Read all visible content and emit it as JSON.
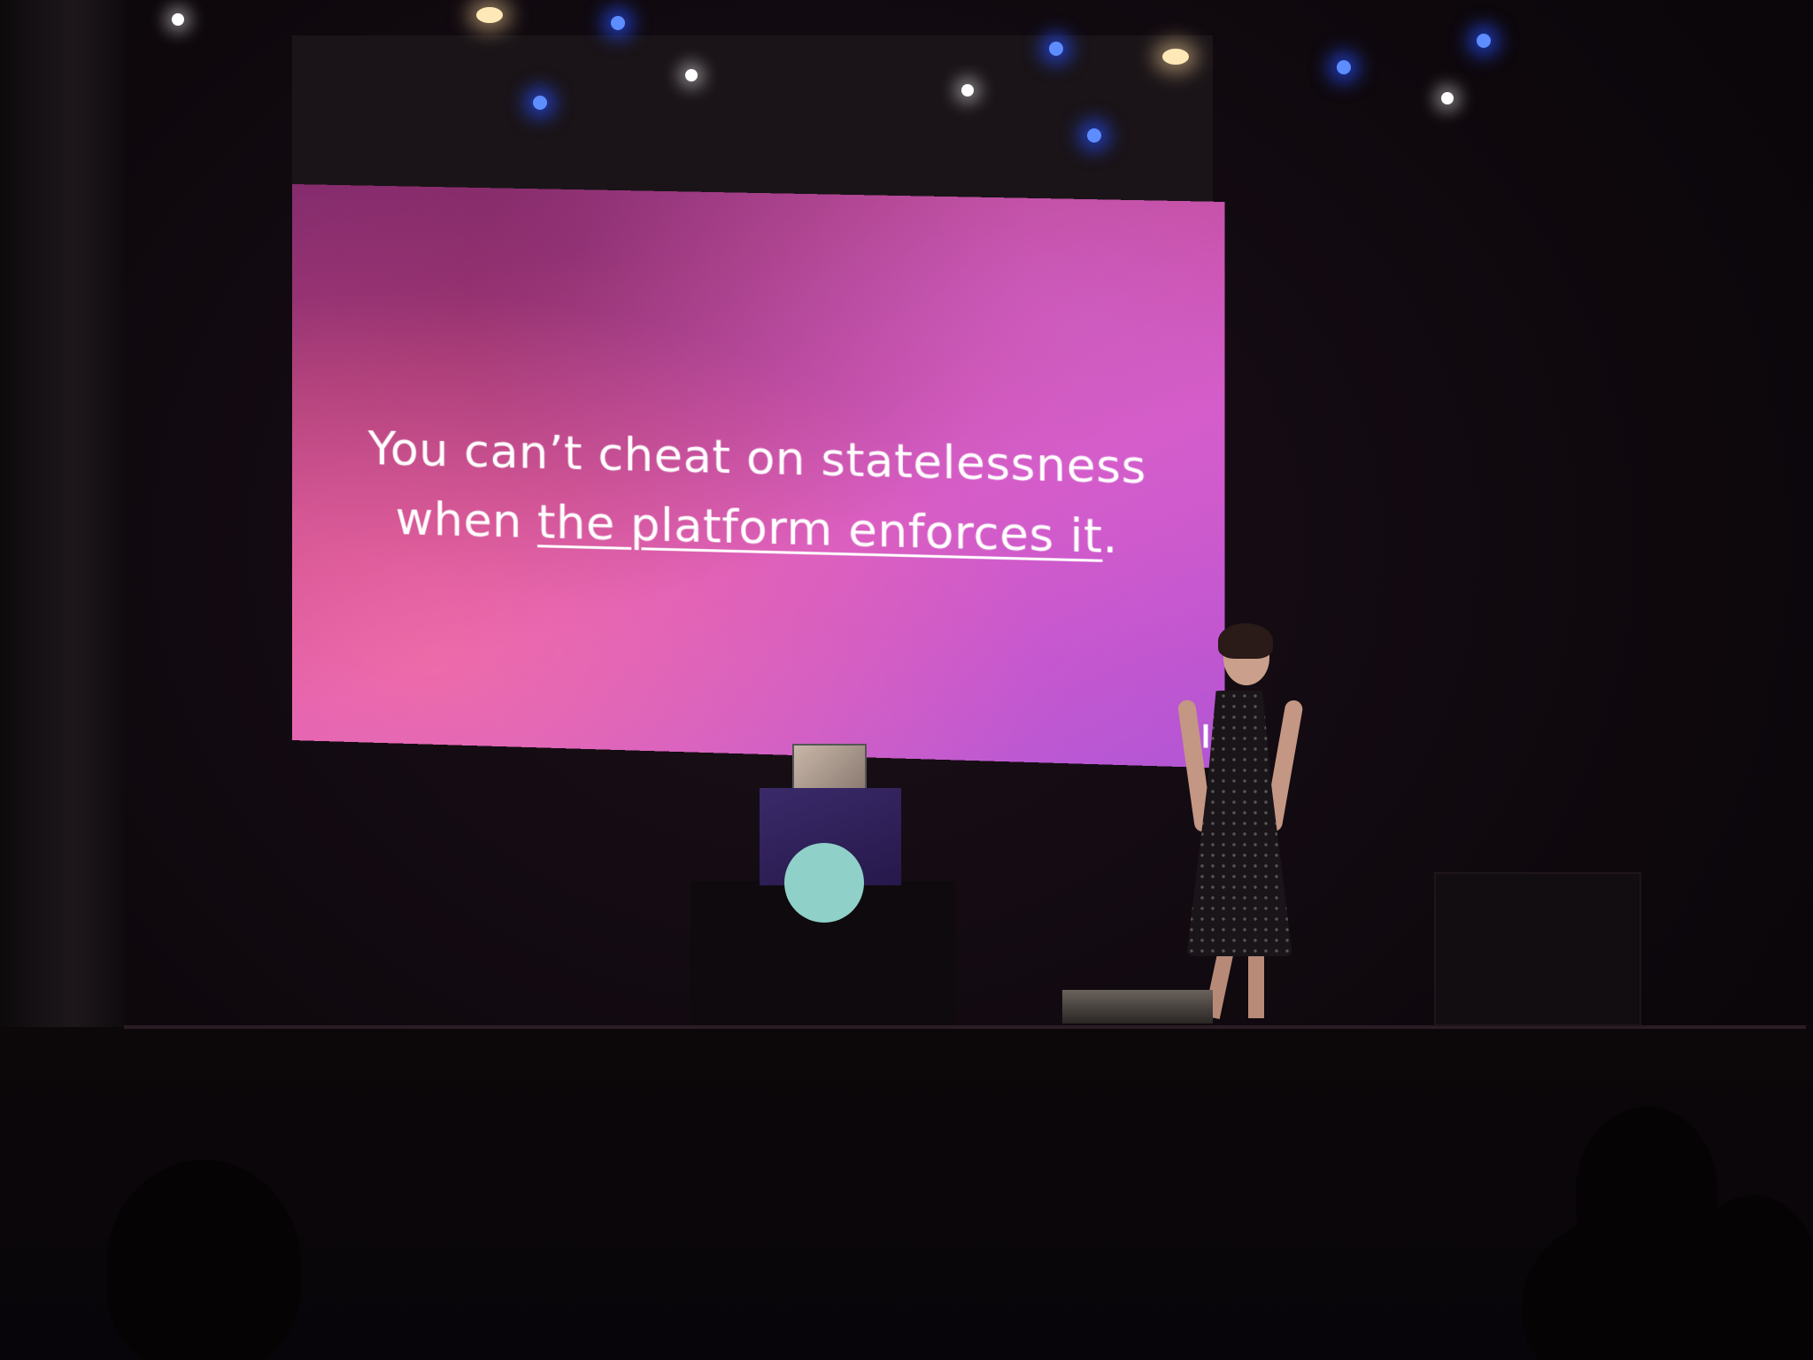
{
  "slide": {
    "line1": "You can’t cheat on statelessness",
    "line2_prefix": "when ",
    "line2_underlined": "the platform enforces it",
    "line2_suffix": "."
  },
  "colors": {
    "slide_gradient_start": "#8a2f72",
    "slide_gradient_mid": "#c94a9c",
    "slide_gradient_end": "#b85dd8",
    "stage_blue_light": "#5d8dff",
    "background": "#0a0608"
  }
}
